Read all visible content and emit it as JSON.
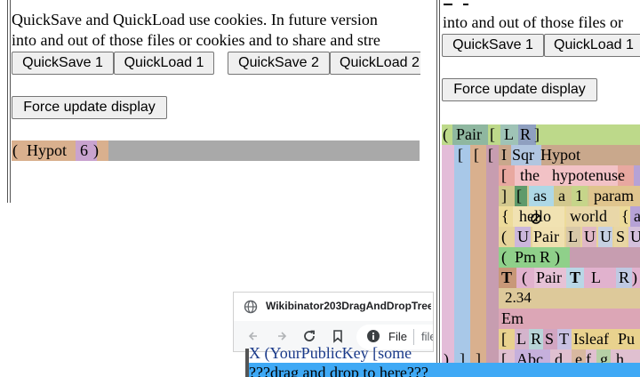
{
  "left_panel": {
    "intro_line1": "QuickSave and QuickLoad use cookies. In future version",
    "intro_line2": "into and out of those files or cookies and to share and stre",
    "quicksave1": "QuickSave 1",
    "quickload1": "QuickLoad 1",
    "quicksave2": "QuickSave 2",
    "quickload2": "QuickLoad 2",
    "force_update": "Force update display",
    "tree": {
      "open": "(",
      "word": "Hypot",
      "num": "6",
      "close": ")"
    }
  },
  "right_panel": {
    "intro_line": "into and out of those files or",
    "quicksave1": "QuickSave 1",
    "quickload1": "QuickLoad 1",
    "force_update": "Force update display",
    "tree": {
      "r1": {
        "open": "(",
        "pair": "Pair",
        "lb": "[",
        "l": "L",
        "r": "R",
        "rb": "]"
      },
      "r2": {
        "b1": "[",
        "b2": "[",
        "b3": "[",
        "i": "I",
        "sqr": "Sqr",
        "hypot": "Hypot"
      },
      "r3": {
        "lb": "[",
        "the": "the",
        "hyp": "hypotenuse"
      },
      "r4": {
        "rb": "]",
        "lb": "[",
        "as": "as",
        "a": "a",
        "one": "1",
        "param": "param"
      },
      "r5": {
        "lc": "{",
        "hello": "hello",
        "world": "world",
        "lc2": "{",
        "a": "a"
      },
      "r6": {
        "open": "(",
        "u": "U",
        "pair": "Pair",
        "l": "L",
        "u2": "U",
        "u3": "U",
        "s": "S",
        "u4": "U"
      },
      "r7": {
        "open": "(",
        "pm": "Pm",
        "r": "R",
        "close": ")"
      },
      "r8": {
        "t": "T",
        "open": "(",
        "pair": "Pair",
        "t2": "T",
        "l": "L",
        "r": "R",
        "close": ")"
      },
      "r9": {
        "num": "2.34"
      },
      "r10": {
        "em": "Em"
      },
      "r11": {
        "lb": "[",
        "l": "L",
        "r": "R",
        "s": "S",
        "t": "T",
        "isleaf": "Isleaf",
        "pu": "Pu"
      },
      "r12": {
        "c1": ")",
        "c2": "]",
        "c3": "]",
        "lb": "[",
        "abc": "Abc",
        "d": "d",
        "e": "e",
        "f": "f",
        "g": "g",
        "h": "h"
      }
    },
    "bottom_line1": "X (YourPublicKey [some",
    "bottom_line2": "???drag and drop to here???"
  },
  "browser_popup": {
    "tab_title": "Wikibinator203DragAndDropTree",
    "address_file": "File",
    "address_path": "file"
  },
  "colors": {
    "gray_bar": "#a9a9a9",
    "tree_paren": "#d9b08e",
    "drop_zone": "#3fa9f5"
  }
}
